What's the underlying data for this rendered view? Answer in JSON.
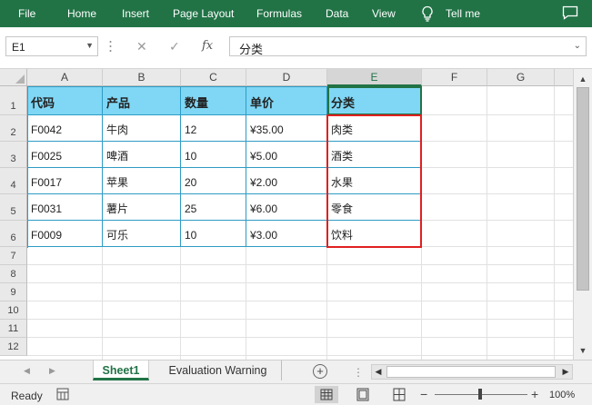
{
  "ribbon": {
    "menu": [
      "File",
      "Home",
      "Insert",
      "Page Layout",
      "Formulas",
      "Data",
      "View"
    ],
    "tell_me": "Tell me",
    "icons": [
      "lightbulb-icon",
      "comment-icon"
    ],
    "bg_color": "#217346"
  },
  "formula_bar": {
    "name_box": "E1",
    "cancel": "✕",
    "enter": "✓",
    "fx": "fx",
    "content": "分类"
  },
  "columns": [
    "A",
    "B",
    "C",
    "D",
    "E",
    "F",
    "G"
  ],
  "rows": [
    "1",
    "2",
    "3",
    "4",
    "5",
    "6",
    "7",
    "8",
    "9",
    "10",
    "11",
    "12"
  ],
  "table": {
    "headers": [
      "代码",
      "产品",
      "数量",
      "单价",
      "分类"
    ],
    "rows": [
      [
        "F0042",
        "牛肉",
        "12",
        "¥35.00",
        "肉类"
      ],
      [
        "F0025",
        "啤酒",
        "10",
        "¥5.00",
        "酒类"
      ],
      [
        "F0017",
        "苹果",
        "20",
        "¥2.00",
        "水果"
      ],
      [
        "F0031",
        "薯片",
        "25",
        "¥6.00",
        "零食"
      ],
      [
        "F0009",
        "可乐",
        "10",
        "¥3.00",
        "饮料"
      ]
    ],
    "header_color": "#7fd7f5",
    "border_color": "#2e9bc4",
    "highlight_color": "#e02020"
  },
  "sheets": {
    "active": "Sheet1",
    "others": [
      "Evaluation Warning"
    ]
  },
  "status": {
    "ready": "Ready",
    "zoom": "100%"
  }
}
